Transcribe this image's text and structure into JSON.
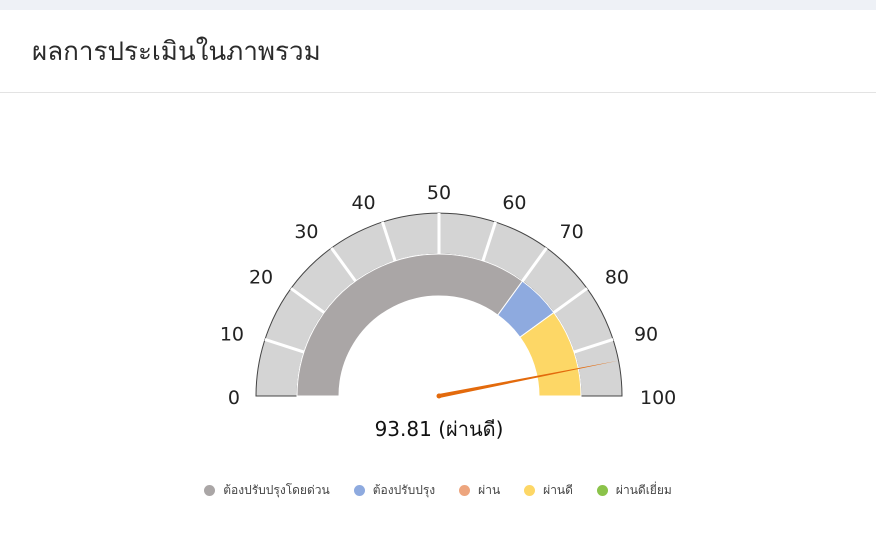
{
  "header": {
    "title": "ผลการประเมินในภาพรวม"
  },
  "chart_data": {
    "type": "gauge",
    "min": 0,
    "max": 100,
    "value": 93.81,
    "value_text": "93.81 (ผ่านดี)",
    "ticks": [
      "0",
      "10",
      "20",
      "30",
      "40",
      "50",
      "60",
      "70",
      "80",
      "90",
      "100"
    ],
    "bands": [
      {
        "name": "ต้องปรับปรุงโดยด่วน",
        "from": 0,
        "to": 70,
        "color": "#aaa6a6"
      },
      {
        "name": "ต้องปรับปรุง",
        "from": 70,
        "to": 80,
        "color": "#8eaadf"
      },
      {
        "name": "ผ่าน",
        "from": 80,
        "to": 80,
        "color": "#eda57e"
      },
      {
        "name": "ผ่านดี",
        "from": 80,
        "to": 100,
        "color": "#fdd766"
      },
      {
        "name": "ผ่านดีเยี่ยม",
        "from": 100,
        "to": 100,
        "color": "#8bc34a"
      }
    ],
    "outer_ring_color": "#d4d4d4",
    "needle_color": "#e36a0c"
  },
  "legend": [
    {
      "label": "ต้องปรับปรุงโดยด่วน",
      "color": "#aaa6a6"
    },
    {
      "label": "ต้องปรับปรุง",
      "color": "#8eaadf"
    },
    {
      "label": "ผ่าน",
      "color": "#eda57e"
    },
    {
      "label": "ผ่านดี",
      "color": "#fdd766"
    },
    {
      "label": "ผ่านดีเยี่ยม",
      "color": "#8bc34a"
    }
  ]
}
